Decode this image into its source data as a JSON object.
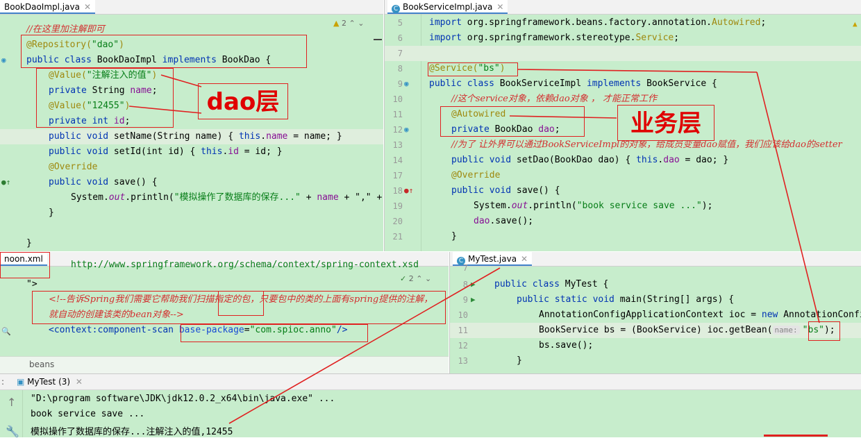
{
  "dao_pane": {
    "tab": "BookDaoImpl.java",
    "inspect_count": "2",
    "lines": {
      "l1": "//在这里加注解即可",
      "l2a": "@Repository(",
      "l2b": "\"dao\"",
      "l2c": ")",
      "l3a": "public class ",
      "l3b": "BookDaoImpl ",
      "l3c": "implements ",
      "l3d": "BookDao {",
      "l4a": "@Value(",
      "l4b": "\"注解注入的值\"",
      "l4c": ")",
      "l5a": "private ",
      "l5b": "String ",
      "l5c": "name",
      "l5d": ";",
      "l6a": "@Value(",
      "l6b": "\"12455\"",
      "l6c": ")",
      "l7a": "private int ",
      "l7b": "id",
      "l7c": ";",
      "l8a": "public void ",
      "l8b": "setName(String name) { ",
      "l8c": "this",
      "l8d": ".",
      "l8e": "name",
      "l8f": " = name; }",
      "l9a": "public void ",
      "l9b": "setId(int id) { ",
      "l9c": "this",
      "l9d": ".",
      "l9e": "id",
      "l9f": " = id; }",
      "l10": "@Override",
      "l11a": "public void ",
      "l11b": "save() {",
      "l12a": "System.",
      "l12b": "out",
      "l12c": ".println(",
      "l12d": "\"模拟操作了数据库的保存...\"",
      "l12e": " + ",
      "l12f": "name",
      "l12g": " + \",\" +",
      "l13": "}",
      "l14": "}"
    },
    "label": "dao层"
  },
  "service_pane": {
    "tab": "BookServiceImpl.java",
    "line_numbers": [
      "5",
      "6",
      "7",
      "8",
      "9",
      "10",
      "11",
      "12",
      "13",
      "14",
      "17",
      "18",
      "19",
      "20",
      "21"
    ],
    "lines": {
      "l5a": "import ",
      "l5b": "org.springframework.beans.factory.annotation.",
      "l5c": "Autowired",
      "l5d": ";",
      "l6a": "import ",
      "l6b": "org.springframework.stereotype.",
      "l6c": "Service",
      "l6d": ";",
      "l8a": "@Service(",
      "l8b": "\"bs\"",
      "l8c": ")",
      "l9a": "public class ",
      "l9b": "BookServiceImpl ",
      "l9c": "implements ",
      "l9d": "BookService {",
      "l10": "//这个service对象，依赖dao对象 ， 才能正常工作",
      "l11": "@Autowired",
      "l12a": "private ",
      "l12b": "BookDao ",
      "l12c": "dao",
      "l12d": ";",
      "l13": "//为了 让外界可以通过BookServiceImpl的对象，给成员变量dao赋值，我们应该给dao的setter",
      "l14a": "public void ",
      "l14b": "setDao(BookDao dao) { ",
      "l14c": "this",
      "l14d": ".",
      "l14e": "dao",
      "l14f": " = dao; }",
      "l17": "@Override",
      "l18a": "public void ",
      "l18b": "save() {",
      "l19a": "System.",
      "l19b": "out",
      "l19c": ".println(",
      "l19d": "\"book service save ...\"",
      "l19e": ");",
      "l20a": "dao",
      "l20b": ".save();",
      "l21": "}"
    },
    "label": "业务层"
  },
  "xml_pane": {
    "tab": "noon.xml",
    "inspect_count": "2",
    "url_line": "http://www.springframework.org/schema/context/spring-context.xsd",
    "close_tag": "\">",
    "comment1": "<!--告诉Spring我们需要它帮助我们扫描指定的包，只要包中的类的上面有spring提供的注解，",
    "comment2": "就自动的创建该类的bean对象-->",
    "scan_a": "<context:component-scan ",
    "scan_b": "base-package",
    "scan_c": "=",
    "scan_d": "\"com.spioc.anno\"",
    "scan_e": "/>",
    "footer": "beans"
  },
  "test_pane": {
    "tab": "MyTest.java",
    "line_numbers": [
      "7",
      "8",
      "9",
      "10",
      "11",
      "12",
      "13"
    ],
    "lines": {
      "l8a": "public class ",
      "l8b": "MyTest {",
      "l9a": "public static void ",
      "l9b": "main(String[] args) {",
      "l10a": "AnnotationConfigApplicationContext ioc = ",
      "l10b": "new ",
      "l10c": "AnnotationConfigApplicationContext",
      "l11a": "BookService bs = (BookService) ioc.getBean(",
      "l11hint": "name:",
      "l11b": "\"bs\"",
      "l11c": ");",
      "l12": "bs.save();",
      "l13": "}"
    }
  },
  "console": {
    "tab": "MyTest (3)",
    "line1": "\"D:\\program software\\JDK\\jdk12.0.2_x64\\bin\\java.exe\" ...",
    "line2": "book service save ...",
    "line3": "模拟操作了数据库的保存...注解注入的值,12455"
  },
  "colors": {
    "editor_bg": "#c7edcc",
    "annotation_red": "#e02020",
    "keyword": "#0033b3",
    "string": "#067d17"
  }
}
